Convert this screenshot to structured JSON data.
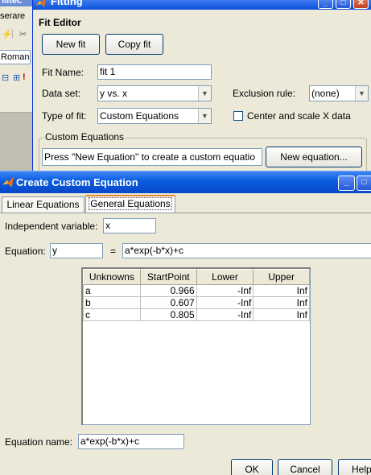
{
  "bg_window": {
    "title": "ilitec",
    "label_top": "serare",
    "field_value": "Roman",
    "tool_glyphs": [
      "⚡",
      "✂",
      "⊟",
      "⊞"
    ]
  },
  "fitting": {
    "title": "Fitting",
    "section": "Fit Editor",
    "new_fit": "New fit",
    "copy_fit": "Copy fit",
    "fit_name_label": "Fit Name:",
    "fit_name_value": "fit 1",
    "data_set_label": "Data set:",
    "data_set_value": "y vs. x",
    "exclusion_label": "Exclusion rule:",
    "exclusion_value": "(none)",
    "type_label": "Type of fit:",
    "type_value": "Custom Equations",
    "center_scale_label": "Center and scale X data",
    "group_title": "Custom Equations",
    "hint_text": "Press \"New Equation\" to create a custom equatio",
    "new_equation": "New equation..."
  },
  "dialog": {
    "title": "Create Custom Equation",
    "tabs": [
      "Linear Equations",
      "General Equations"
    ],
    "indep_label": "Independent variable:",
    "indep_value": "x",
    "equation_label": "Equation:",
    "equation_lhs": "y",
    "equals": "=",
    "equation_rhs": "a*exp(-b*x)+c",
    "table": {
      "headers": [
        "Unknowns",
        "StartPoint",
        "Lower",
        "Upper"
      ],
      "rows": [
        [
          "a",
          "0.966",
          "-Inf",
          "Inf"
        ],
        [
          "b",
          "0.607",
          "-Inf",
          "Inf"
        ],
        [
          "c",
          "0.805",
          "-Inf",
          "Inf"
        ]
      ]
    },
    "name_label": "Equation name:",
    "name_value": "a*exp(-b*x)+c",
    "ok": "OK",
    "cancel": "Cancel",
    "help": "Help"
  }
}
